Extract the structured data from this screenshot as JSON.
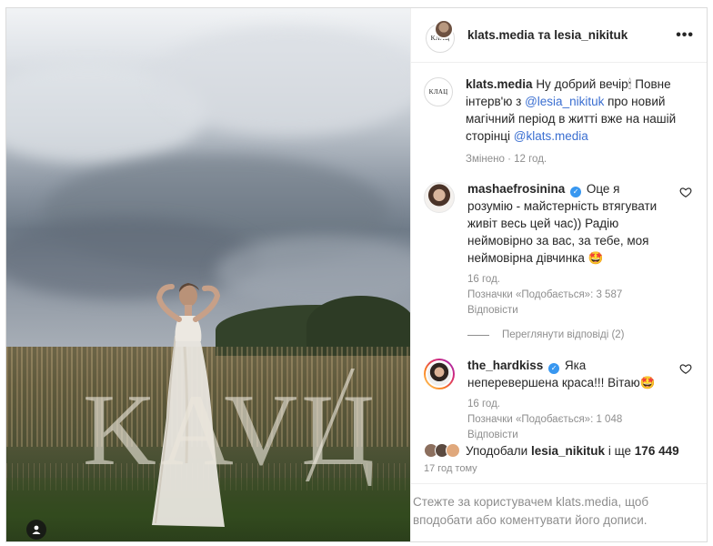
{
  "header": {
    "user1": "klats.media",
    "conjunction": "та",
    "user2": "lesia_nikituk",
    "more": "•••"
  },
  "photo": {
    "watermark": "KAVЦ",
    "tag_icon": "user-tag-icon"
  },
  "caption": {
    "avatar_text": "KЛAЦ",
    "username": "klats.media",
    "text_1": "Ну добрий вечір",
    "emoji": "🕯",
    "text_2": "Повне інтерв'ю з",
    "mention_1": "@lesia_nikituk",
    "text_3": "про новий магічний період в житті вже на нашій сторінці",
    "mention_2": "@klats.media",
    "meta": "Змінено · 12 год."
  },
  "comments": [
    {
      "username": "mashaefrosinina",
      "verified": true,
      "text": "Оце я розумію - майстерність втягувати живіт весь цей час)) Радію неймовірно за вас, за тебе, моя неймовірна дівчинка 🤩",
      "time": "16 год.",
      "likes": "Позначки «Подобається»: 3 587",
      "reply": "Відповісти"
    },
    {
      "username": "the_hardkiss",
      "verified": true,
      "text": "Яка неперевершена краса!!! Вітаю🤩",
      "time": "16 год.",
      "likes": "Позначки «Подобається»: 1 048",
      "reply": "Відповісти"
    }
  ],
  "view_replies": "Переглянути відповіді (2)",
  "likes": {
    "prefix": "Уподобали",
    "user": "lesia_nikituk",
    "middle": "і ще",
    "count": "176 449"
  },
  "timestamp": "17 год тому",
  "footer": {
    "line1": "Стежте за користувачем klats.media, щоб",
    "line2": "вподобати або коментувати його дописи."
  },
  "colors": {
    "link": "#3b6fd1",
    "verified": "#3897f0",
    "muted": "#8e8e8e"
  }
}
